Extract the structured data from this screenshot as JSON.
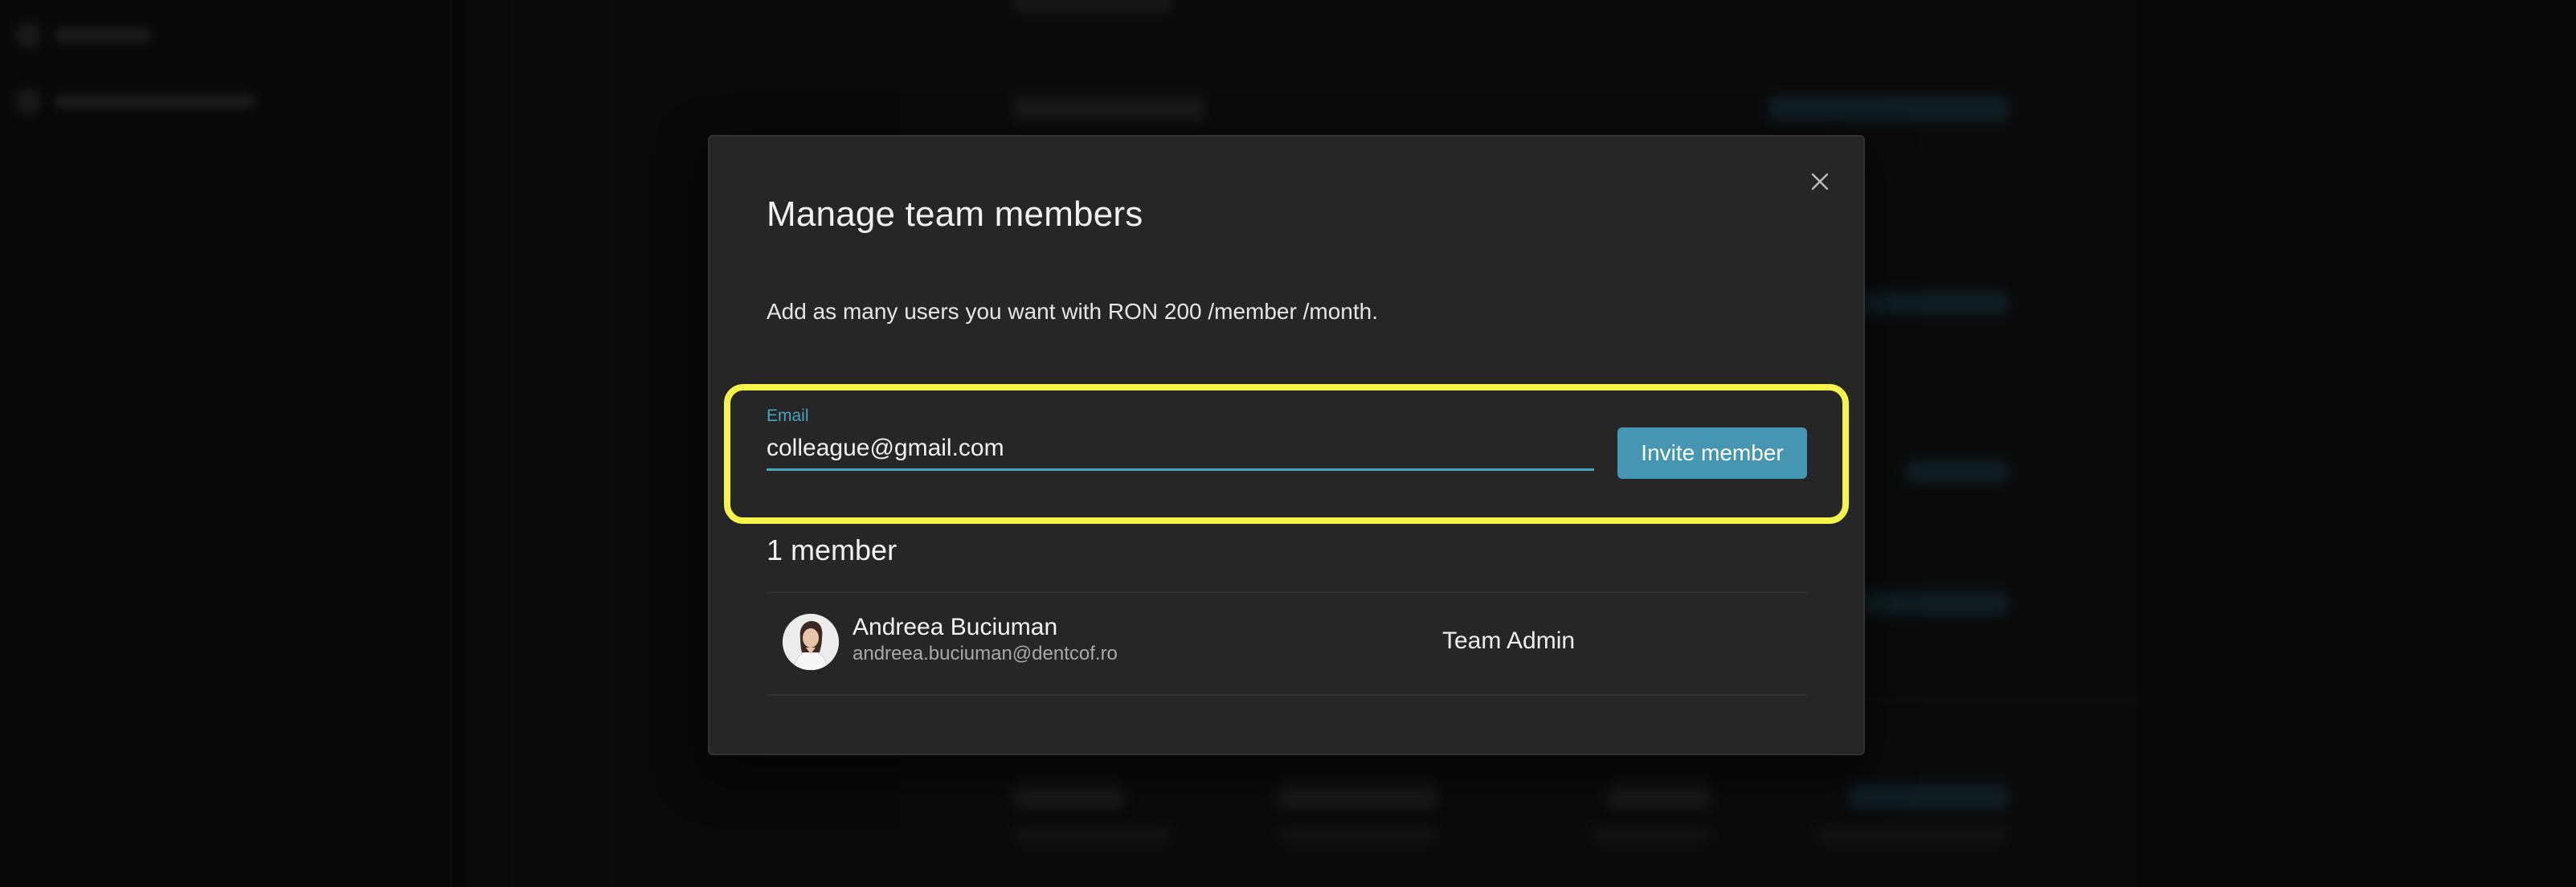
{
  "modal": {
    "title": "Manage team members",
    "description": "Add as many users you want with RON 200 /member /month.",
    "close_icon": "close-icon"
  },
  "invite_form": {
    "email_label": "Email",
    "email_value": "colleague@gmail.com",
    "invite_button_label": "Invite member",
    "highlight_color": "#f4f44a",
    "accent_color": "#4496b3"
  },
  "members": {
    "count_label": "1 member",
    "list": [
      {
        "name": "Andreea Buciuman",
        "email": "andreea.buciuman@dentcof.ro",
        "role": "Team Admin",
        "avatar_icon": "avatar"
      }
    ]
  }
}
